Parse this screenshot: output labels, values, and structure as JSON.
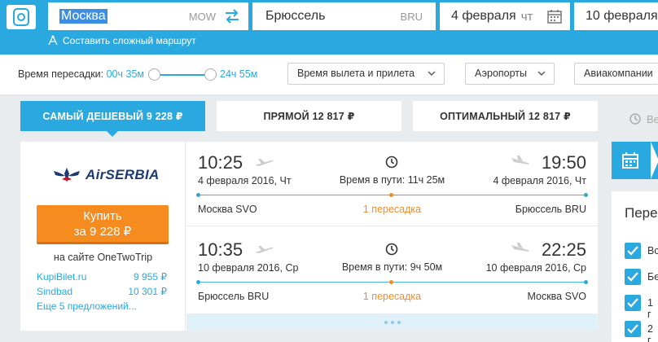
{
  "search": {
    "from_city": "Москва",
    "from_code": "MOW",
    "to_city": "Брюссель",
    "to_code": "BRU",
    "depart_date": "4 февраля",
    "depart_weekday": "чт",
    "return_date": "10 февраля",
    "complex_route_label": "Составить сложный маршрут"
  },
  "filters": {
    "transfer_label": "Время пересадки:",
    "transfer_min": "00ч 35м",
    "transfer_max": "24ч 55м",
    "departure_arrival_label": "Время вылета и прилета",
    "airports_label": "Аэропорты",
    "airlines_label": "Авиакомпании"
  },
  "tabs": {
    "cheapest": "САМЫЙ ДЕШЕВЫЙ 9 228 ₽",
    "direct": "ПРЯМОЙ 12 817 ₽",
    "optimal": "ОПТИМАЛЬНЫЙ 12 817 ₽",
    "history_fragment": "Ве"
  },
  "result": {
    "airline_name": "AirSERBIA",
    "buy_label": "Купить",
    "buy_price": "за 9 228 ₽",
    "site_label": "на сайте OneTwoTrip",
    "offers": [
      {
        "name": "KupiBilet.ru",
        "price": "9 955 ₽"
      },
      {
        "name": "Sindbad",
        "price": "10 301 ₽"
      }
    ],
    "more_offers": "Еще 5 предложений...",
    "legs": [
      {
        "dep_time": "10:25",
        "dep_date": "4 февраля 2016, Чт",
        "arr_time": "19:50",
        "arr_date": "4 февраля 2016, Чт",
        "duration": "Время в пути: 11ч 25м",
        "dep_airport": "Москва SVO",
        "arr_airport": "Брюссель BRU",
        "stops": "1 пересадка"
      },
      {
        "dep_time": "10:35",
        "dep_date": "10 февраля 2016, Ср",
        "arr_time": "22:25",
        "arr_date": "10 февраля 2016, Ср",
        "duration": "Время в пути: 9ч 50м",
        "dep_airport": "Брюссель BRU",
        "arr_airport": "Москва SVO",
        "stops": "1 пересадка"
      }
    ]
  },
  "side_panel": {
    "title_fragment": "Пере",
    "checkbox_labels": [
      "Вс",
      "Бе",
      "1 г",
      "2 г"
    ]
  },
  "colors": {
    "accent": "#29a9e0",
    "buy": "#f68b1f",
    "stops": "#f68b1f"
  }
}
